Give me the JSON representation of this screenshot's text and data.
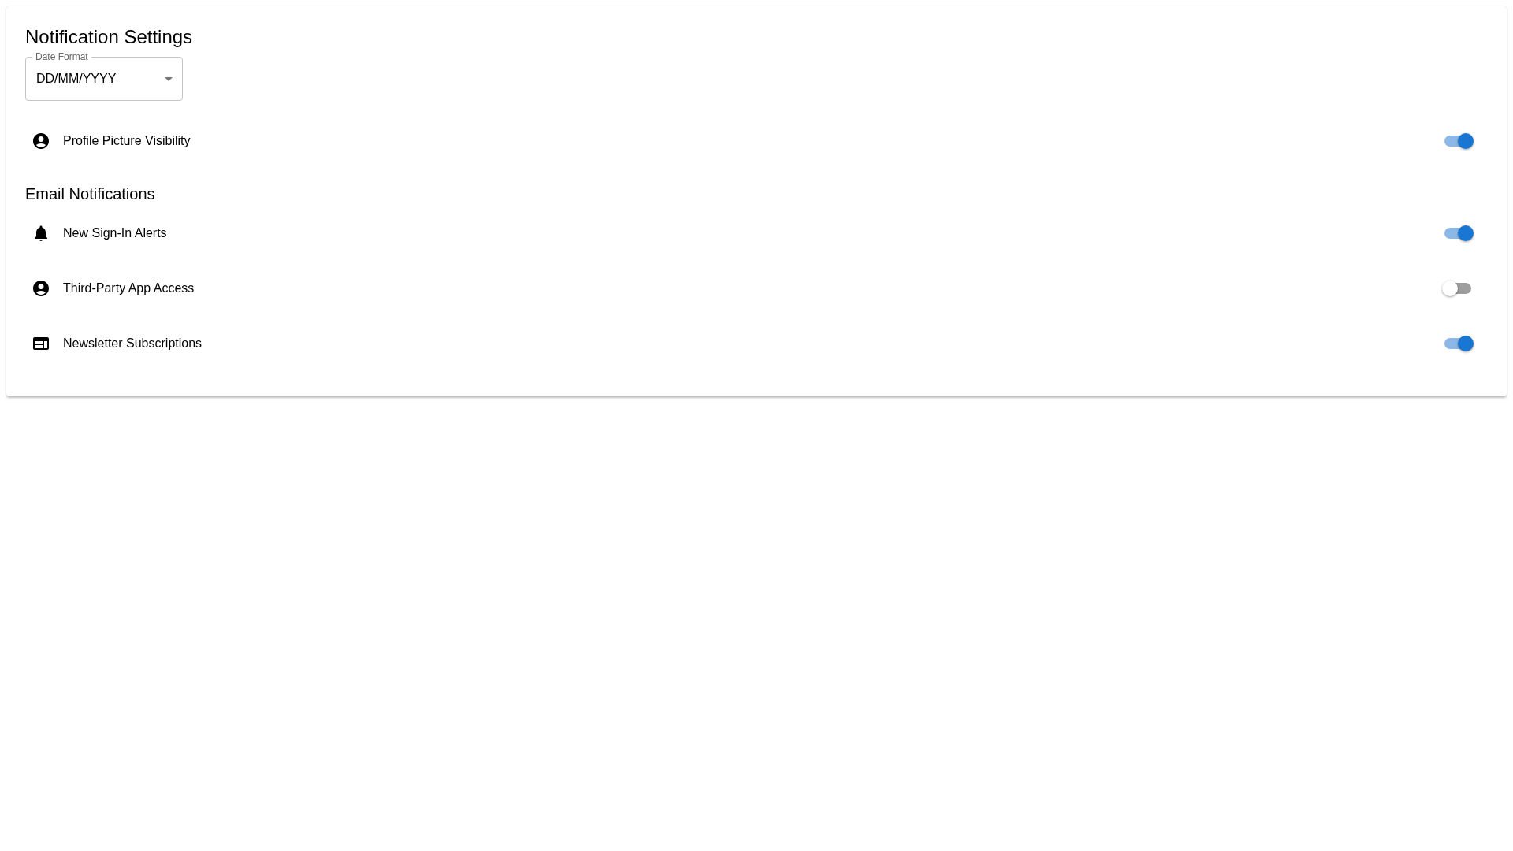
{
  "title": "Notification Settings",
  "date_format": {
    "label": "Date Format",
    "value": "DD/MM/YYYY"
  },
  "profile_setting": {
    "label": "Profile Picture Visibility",
    "on": true
  },
  "email_notifications": {
    "heading": "Email Notifications",
    "items": [
      {
        "label": "New Sign-In Alerts",
        "on": true
      },
      {
        "label": "Third-Party App Access",
        "on": false
      },
      {
        "label": "Newsletter Subscriptions",
        "on": true
      }
    ]
  }
}
